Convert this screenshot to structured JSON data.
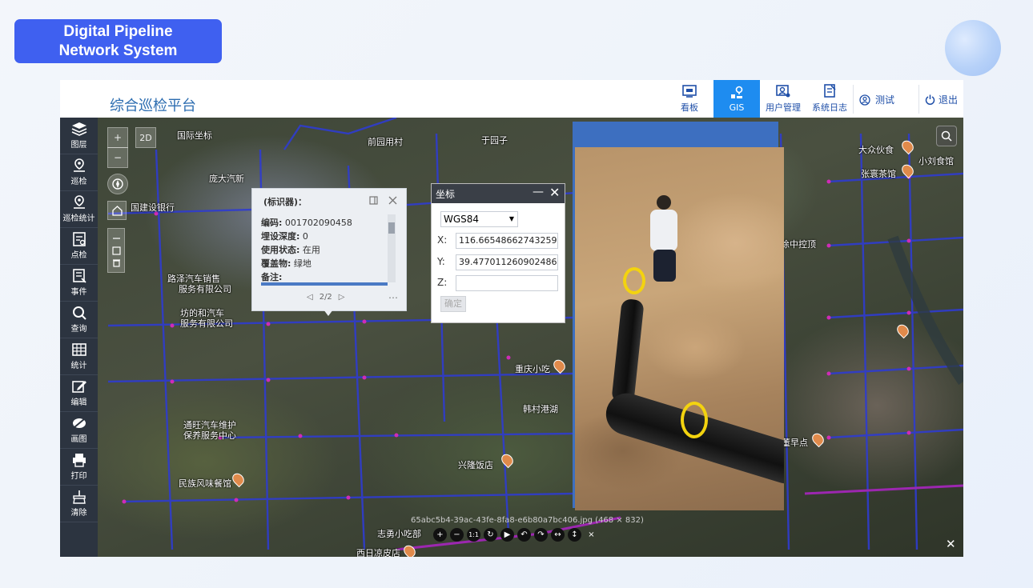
{
  "badge": {
    "line1": "Digital Pipeline",
    "line2": "Network System"
  },
  "app": {
    "title": "综合巡检平台"
  },
  "nav": {
    "items": [
      {
        "label": "看板",
        "icon": "dashboard-icon"
      },
      {
        "label": "GIS",
        "icon": "gis-map-icon",
        "active": true
      },
      {
        "label": "用户管理",
        "icon": "users-icon"
      },
      {
        "label": "系统日志",
        "icon": "log-icon"
      }
    ],
    "user": "测试",
    "logout": "退出"
  },
  "sidebar": {
    "items": [
      {
        "label": "图层",
        "icon": "layers-icon"
      },
      {
        "label": "巡检",
        "icon": "location-icon"
      },
      {
        "label": "巡检统计",
        "icon": "inspection-stats-icon"
      },
      {
        "label": "点检",
        "icon": "checklist-icon"
      },
      {
        "label": "事件",
        "icon": "event-icon"
      },
      {
        "label": "查询",
        "icon": "search-icon"
      },
      {
        "label": "统计",
        "icon": "table-icon"
      },
      {
        "label": "编辑",
        "icon": "edit-icon"
      },
      {
        "label": "画图",
        "icon": "draw-icon"
      },
      {
        "label": "打印",
        "icon": "print-icon"
      },
      {
        "label": "清除",
        "icon": "clear-icon"
      }
    ]
  },
  "mapcontrols": {
    "zoom_in": "+",
    "zoom_out": "−",
    "view_2d": "2D"
  },
  "label_popup": {
    "title": "(标识器)：",
    "fields": [
      {
        "key": "编码:",
        "value": "001702090458"
      },
      {
        "key": "埋设深度:",
        "value": "0"
      },
      {
        "key": "使用状态:",
        "value": "在用"
      },
      {
        "key": "覆盖物:",
        "value": "绿地"
      },
      {
        "key": "备注:",
        "value": ""
      }
    ],
    "pager": "2/2"
  },
  "coord_panel": {
    "title": "坐标",
    "crs": "WGS84",
    "x_label": "X:",
    "x_value": "116.665486627432​59",
    "y_label": "Y:",
    "y_value": "39.477011260902486",
    "z_label": "Z:",
    "z_value": "",
    "confirm": "确定"
  },
  "viewer": {
    "caption": "65abc5b4-39ac-43fe-8fa8-e6b80a7bc406.jpg (468 × 832)",
    "toolbar": [
      "+",
      "−",
      "1:1",
      "↻",
      "▶",
      "↶",
      "↷",
      "↔",
      "↕",
      "×"
    ]
  },
  "map_labels": [
    "国际坐标",
    "庞大汽新",
    "国建设银行",
    "路泽汽车销售",
    "服务有限公司",
    "坊的和汽车",
    "服务有限公司",
    "通旺汽车维护",
    "保养服务中心",
    "民族风味餐馆",
    "大众伙食",
    "张寰茶馆",
    "小刘食馆",
    "徐中控顶",
    "重庆小吃",
    "兴隆饭店",
    "志勇小吃部",
    "西日凉皮店",
    "韩村港湖",
    "董早点",
    "于园子",
    "前园用村"
  ]
}
